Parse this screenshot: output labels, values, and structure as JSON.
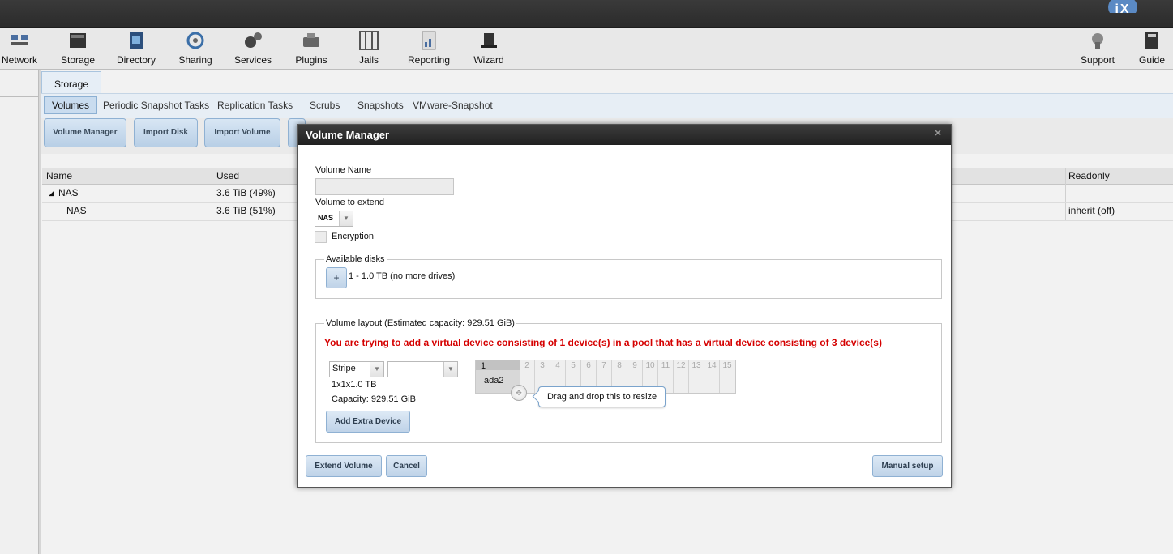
{
  "toolbar": {
    "items": [
      {
        "label": "Network",
        "icon": "network-icon"
      },
      {
        "label": "Storage",
        "icon": "storage-icon"
      },
      {
        "label": "Directory",
        "icon": "directory-icon"
      },
      {
        "label": "Sharing",
        "icon": "sharing-icon"
      },
      {
        "label": "Services",
        "icon": "services-icon"
      },
      {
        "label": "Plugins",
        "icon": "plugins-icon"
      },
      {
        "label": "Jails",
        "icon": "jails-icon"
      },
      {
        "label": "Reporting",
        "icon": "reporting-icon"
      },
      {
        "label": "Wizard",
        "icon": "wizard-icon"
      },
      {
        "label": "Support",
        "icon": "support-icon"
      },
      {
        "label": "Guide",
        "icon": "guide-icon"
      }
    ]
  },
  "tabs": {
    "main": "Storage",
    "sub": [
      "Volumes",
      "Periodic Snapshot Tasks",
      "Replication Tasks",
      "Scrubs",
      "Snapshots",
      "VMware-Snapshot"
    ]
  },
  "buttons": {
    "volume_manager": "Volume Manager",
    "import_disk": "Import Disk",
    "import_volume": "Import Volume"
  },
  "grid": {
    "columns": [
      "Name",
      "Used",
      "Readonly"
    ],
    "rows": [
      {
        "name": "NAS",
        "used": "3.6 TiB (49%)",
        "readonly": ""
      },
      {
        "name": "NAS",
        "used": "3.6 TiB (51%)",
        "readonly": "inherit (off)"
      }
    ]
  },
  "dialog": {
    "title": "Volume Manager",
    "volume_name_label": "Volume Name",
    "volume_name_value": "",
    "extend_label": "Volume to extend",
    "extend_value": "NAS",
    "encryption_label": "Encryption",
    "available_disks_legend": "Available disks",
    "plus_label": "+",
    "disk_text": "1 - 1.0 TB (no more drives)",
    "layout_legend": "Volume layout (Estimated capacity: 929.51 GiB)",
    "warning": "You are trying to add a virtual device consisting of 1 device(s) in a pool that has a virtual device consisting of 3 device(s)",
    "layout_type": "Stripe",
    "second_select": "",
    "config_text": "1x1x1.0 TB",
    "capacity_text": "Capacity: 929.51 GiB",
    "add_extra_device": "Add Extra Device",
    "slot_selected_number": "1",
    "slot_disk": "ada2",
    "slot_numbers": [
      "2",
      "3",
      "4",
      "5",
      "6",
      "7",
      "8",
      "9",
      "10",
      "11",
      "12",
      "13",
      "14",
      "15"
    ],
    "tooltip": "Drag and drop this to resize",
    "extend_volume": "Extend Volume",
    "cancel": "Cancel",
    "manual_setup": "Manual setup"
  }
}
